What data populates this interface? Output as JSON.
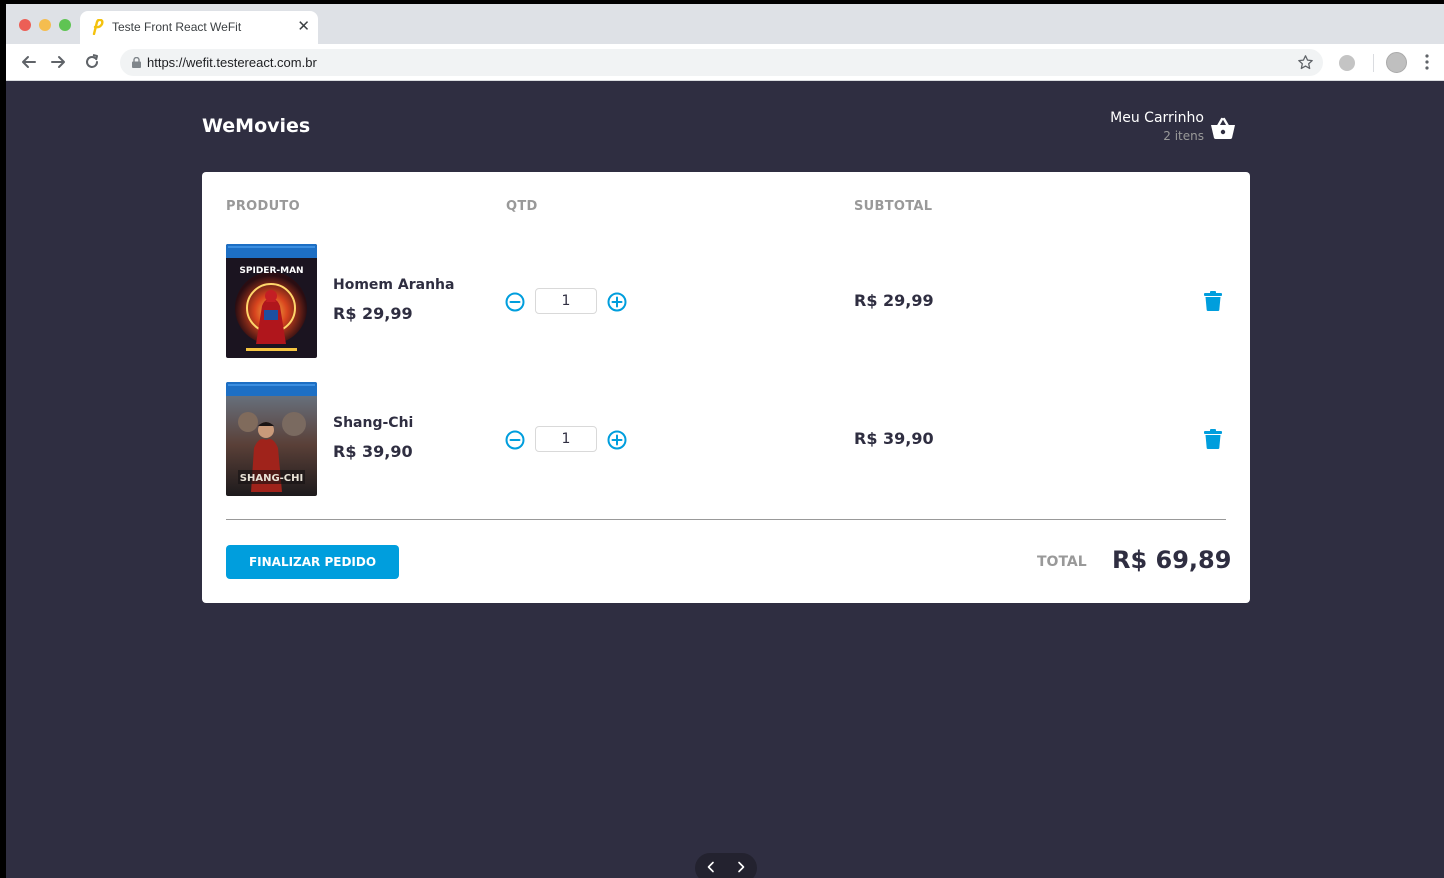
{
  "browser": {
    "tab_title": "Teste Front React WeFit",
    "tab_close_glyph": "✕",
    "url": "https://wefit.testereact.com.br",
    "icons": [
      "back-arrow-icon",
      "forward-arrow-icon",
      "reload-icon",
      "lock-icon",
      "star-icon",
      "extension-icon",
      "profile-icon",
      "menu-dots-icon"
    ]
  },
  "header": {
    "logo": "WeMovies",
    "cart_title": "Meu Carrinho",
    "cart_count": "2 itens",
    "cart_icon": "basket-icon"
  },
  "cart": {
    "columns": {
      "product": "PRODUTO",
      "qty": "QTD",
      "subtotal": "SUBTOTAL"
    },
    "items": [
      {
        "name": "Homem Aranha",
        "price": "R$ 29,99",
        "quantity": "1",
        "subtotal": "R$ 29,99",
        "poster": "spider-man-poster"
      },
      {
        "name": "Shang-Chi",
        "price": "R$ 39,90",
        "quantity": "1",
        "subtotal": "R$ 39,90",
        "poster": "shang-chi-poster"
      }
    ],
    "checkout_label": "FINALIZAR PEDIDO",
    "total_label": "TOTAL",
    "total_value": "R$ 69,89"
  },
  "poster_texts": {
    "spider_man": "SPIDER-MAN",
    "shang_chi": "SHANG-CHI"
  },
  "colors": {
    "accent": "#009edd",
    "background": "#2f2e41",
    "text_dark": "#2f2e41",
    "text_muted": "#999999"
  }
}
